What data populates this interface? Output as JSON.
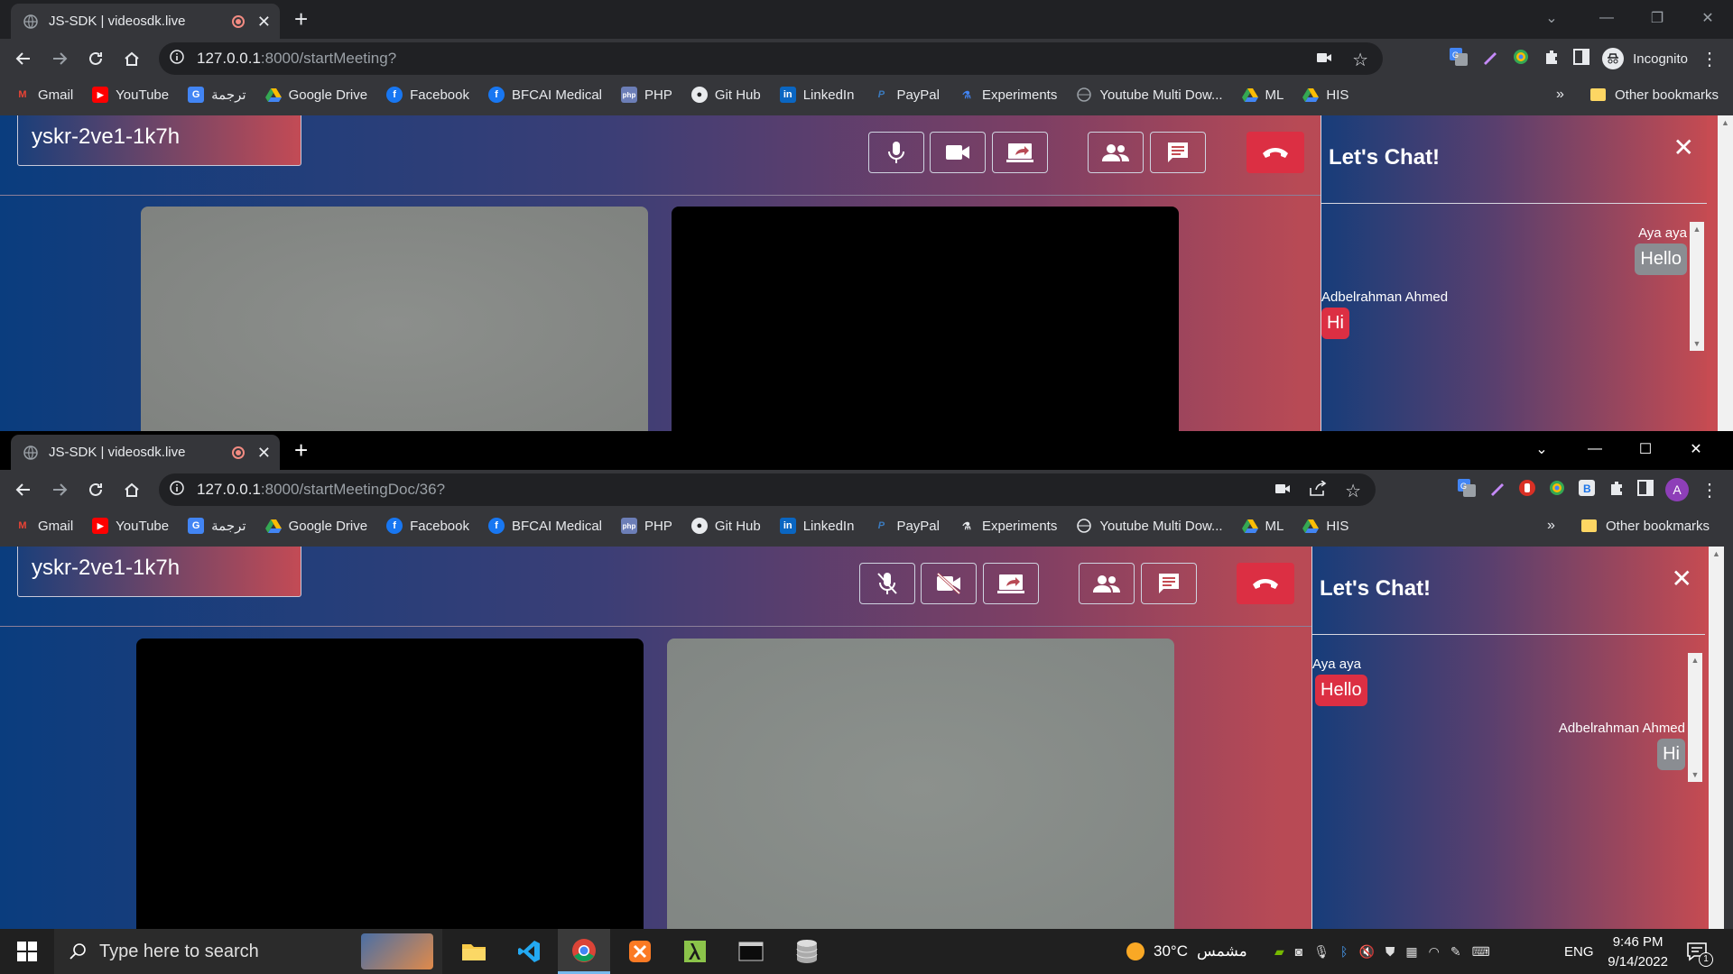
{
  "top_window": {
    "tab_title": "JS-SDK | videosdk.live",
    "url_host": "127.0.0.1",
    "url_path": ":8000/startMeeting?",
    "profile_label": "Incognito",
    "meeting_id": "yskr-2ve1-1k7h",
    "chat_title": "Let's Chat!",
    "messages": [
      {
        "sender": "Aya aya",
        "text": "Hello",
        "side": "right",
        "color": "gray"
      },
      {
        "sender": "Adbelrahman Ahmed",
        "text": "Hi",
        "side": "left",
        "color": "red"
      }
    ]
  },
  "bottom_window": {
    "tab_title": "JS-SDK | videosdk.live",
    "url_host": "127.0.0.1",
    "url_path": ":8000/startMeetingDoc/36?",
    "avatar_letter": "A",
    "meeting_id": "yskr-2ve1-1k7h",
    "chat_title": "Let's Chat!",
    "messages": [
      {
        "sender": "Aya aya",
        "text": "Hello",
        "side": "left",
        "color": "red"
      },
      {
        "sender": "Adbelrahman Ahmed",
        "text": "Hi",
        "side": "right",
        "color": "gray"
      }
    ]
  },
  "bookmarks": [
    "Gmail",
    "YouTube",
    "ترجمة",
    "Google Drive",
    "Facebook",
    "BFCAI Medical",
    "PHP",
    "Git Hub",
    "LinkedIn",
    "PayPal",
    "Experiments",
    "Youtube Multi Dow...",
    "ML",
    "HIS"
  ],
  "bookmark_more": "»",
  "other_bookmarks": "Other bookmarks",
  "taskbar": {
    "search_placeholder": "Type here to search",
    "weather": "30°C",
    "weather_text": "مشمس",
    "language": "ENG",
    "time": "9:46 PM",
    "date": "9/14/2022",
    "notification_count": "1"
  },
  "colors": {
    "accent_red": "#dc2f43",
    "chrome_dark": "#202124",
    "chrome_toolbar": "#35363a"
  }
}
